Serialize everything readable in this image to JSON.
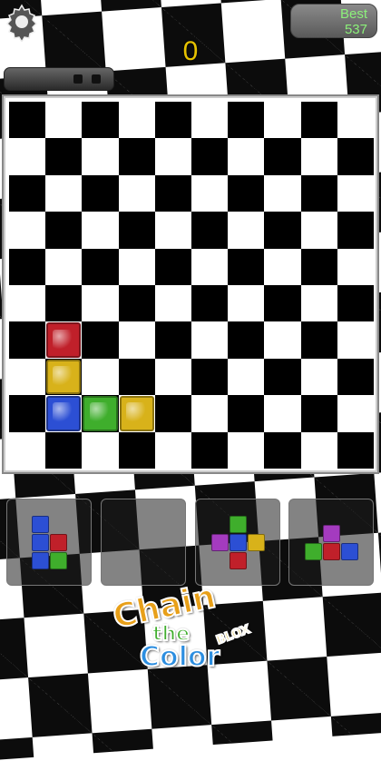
{
  "header": {
    "best_label": "Best",
    "best_value": "537",
    "score": "0"
  },
  "progress": {
    "filled_fraction": 0.0,
    "segments": 2
  },
  "board": {
    "rows": 10,
    "cols": 10,
    "pieces": [
      {
        "row": 6,
        "col": 1,
        "color": "red"
      },
      {
        "row": 7,
        "col": 1,
        "color": "yellow"
      },
      {
        "row": 8,
        "col": 1,
        "color": "blue"
      },
      {
        "row": 8,
        "col": 2,
        "color": "green"
      },
      {
        "row": 8,
        "col": 3,
        "color": "yellow"
      }
    ]
  },
  "colors": {
    "red": "#c0202a",
    "yellow": "#d8b21a",
    "blue": "#2c4fd4",
    "green": "#3fae2c",
    "purple": "#a43bbf",
    "score_color": "#e6c200",
    "best_color": "#8cf07a"
  },
  "tray": [
    {
      "cells": [
        {
          "r": 0,
          "c": 0,
          "color": "blue"
        },
        {
          "r": 1,
          "c": 0,
          "color": "blue"
        },
        {
          "r": 1,
          "c": 1,
          "color": "red"
        },
        {
          "r": 2,
          "c": 0,
          "color": "blue"
        },
        {
          "r": 2,
          "c": 1,
          "color": "green"
        }
      ]
    },
    {
      "cells": []
    },
    {
      "cells": [
        {
          "r": 0,
          "c": 1,
          "color": "green"
        },
        {
          "r": 1,
          "c": 0,
          "color": "purple"
        },
        {
          "r": 1,
          "c": 1,
          "color": "blue"
        },
        {
          "r": 1,
          "c": 2,
          "color": "yellow"
        },
        {
          "r": 2,
          "c": 1,
          "color": "red"
        }
      ]
    },
    {
      "cells": [
        {
          "r": 0,
          "c": 1,
          "color": "purple"
        },
        {
          "r": 1,
          "c": 0,
          "color": "green"
        },
        {
          "r": 1,
          "c": 1,
          "color": "red"
        },
        {
          "r": 1,
          "c": 2,
          "color": "blue"
        }
      ]
    }
  ],
  "logo": {
    "word1": "Chain",
    "word2": "the",
    "word3": "Color",
    "badge": "BLOX"
  }
}
